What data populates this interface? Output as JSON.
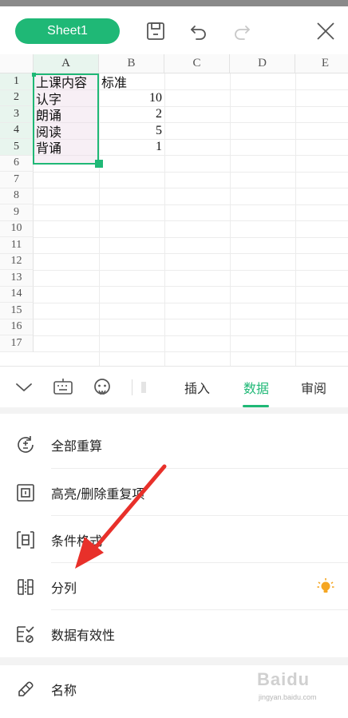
{
  "header": {
    "sheet_label": "Sheet1",
    "save_icon": "save-icon",
    "undo_icon": "undo-icon",
    "redo_icon": "redo-icon",
    "close_icon": "close-icon"
  },
  "grid": {
    "columns": [
      "A",
      "B",
      "C",
      "D",
      "E"
    ],
    "rows": [
      "1",
      "2",
      "3",
      "4",
      "5",
      "6",
      "7",
      "8",
      "9",
      "10",
      "11",
      "12",
      "13",
      "14",
      "15",
      "16",
      "17"
    ],
    "cells": {
      "a1": "上课内容",
      "b1": "标准",
      "a2": "认字",
      "b2": "10",
      "a3": "朗诵",
      "b3": "2",
      "a4": "阅读",
      "b4": "5",
      "a5": "背诵",
      "b5": "1"
    },
    "selection_color": "#1fb876"
  },
  "toolbar": {
    "tabs": [
      "插入",
      "数据",
      "审阅"
    ],
    "active_tab": "数据",
    "accent": "#1fb876"
  },
  "menu": {
    "items": [
      "全部重算",
      "高亮/删除重复项",
      "条件格式",
      "分列",
      "数据有效性",
      "名称"
    ]
  },
  "watermark": {
    "brand": "Baidu",
    "sub": "jingyan.baidu.com"
  },
  "annotation": {
    "arrow_color": "#e8302a"
  }
}
